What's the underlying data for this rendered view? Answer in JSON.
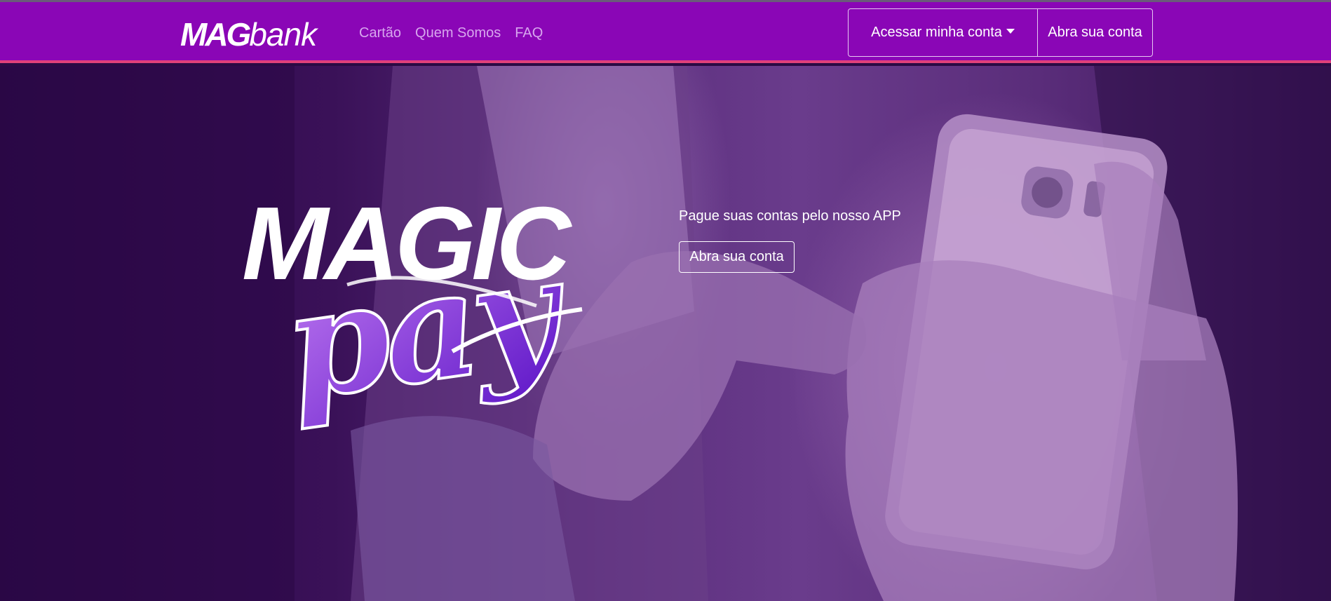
{
  "navbar": {
    "brand_mag": "MAG",
    "brand_bank": "bank",
    "links": [
      {
        "label": "Cartão"
      },
      {
        "label": "Quem Somos"
      },
      {
        "label": "FAQ"
      }
    ],
    "account_button": "Acessar minha conta",
    "open_account_button": "Abra sua conta"
  },
  "hero": {
    "logo_word": "MAGIC",
    "logo_script": "pay",
    "tagline": "Pague suas contas pelo nosso APP",
    "cta_button": "Abra sua conta"
  },
  "colors": {
    "navbar_bg": "#8a06b6",
    "navbar_border": "#e0407a",
    "nav_link": "#d7a6ee",
    "pay_gradient_start": "#b86ef0",
    "pay_gradient_end": "#5a10c8"
  },
  "icons": {
    "dropdown": "caret-down-icon"
  }
}
